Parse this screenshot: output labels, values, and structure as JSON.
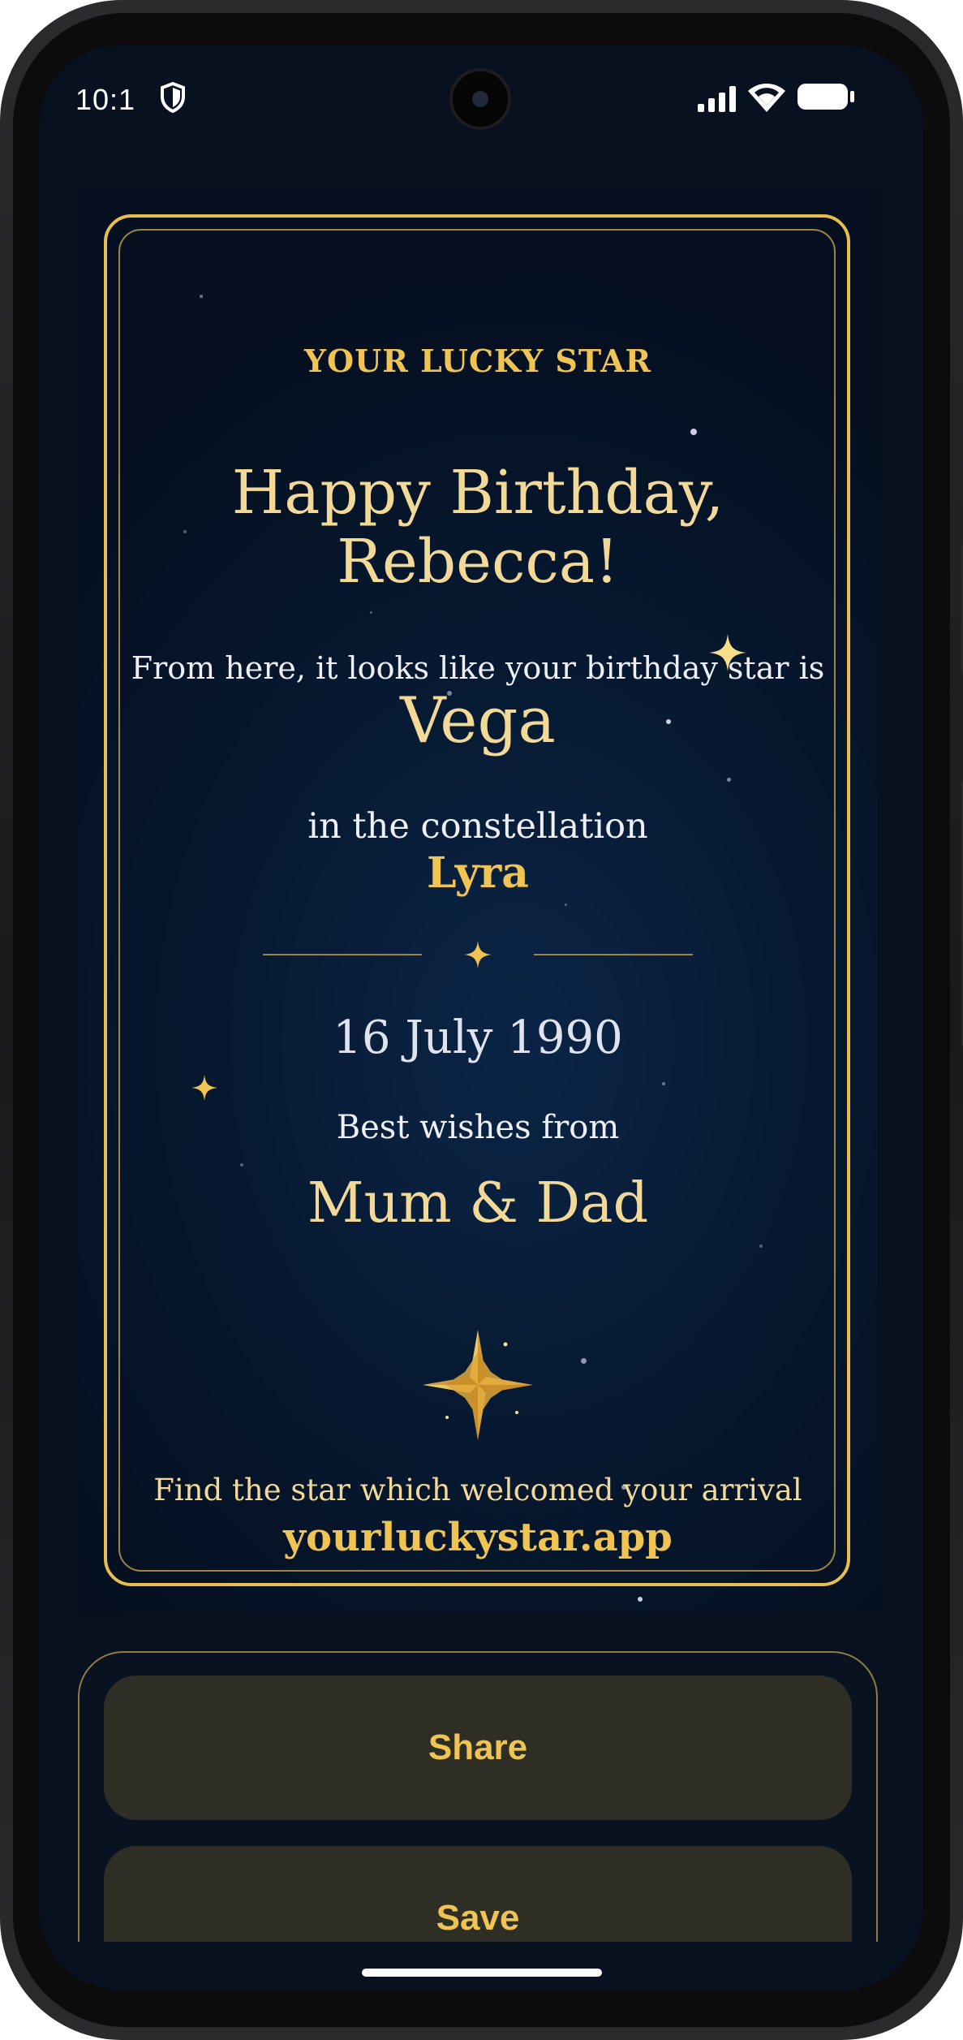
{
  "status": {
    "time": "10:1"
  },
  "card": {
    "label": "YOUR LUCKY STAR",
    "greeting_line1": "Happy Birthday,",
    "greeting_line2": "Rebecca!",
    "intro": "From here, it looks like your birthday star is",
    "star": "Vega",
    "constellation_intro": "in the constellation",
    "constellation": "Lyra",
    "date": "16 July 1990",
    "wishes": "Best wishes from",
    "sender": "Mum & Dad",
    "footer": "Find the star which welcomed your arrival",
    "url": "yourluckystar.app"
  },
  "actions": {
    "share": "Share",
    "save": "Save"
  },
  "colors": {
    "gold": "#f0c452",
    "background": "#08111f"
  }
}
